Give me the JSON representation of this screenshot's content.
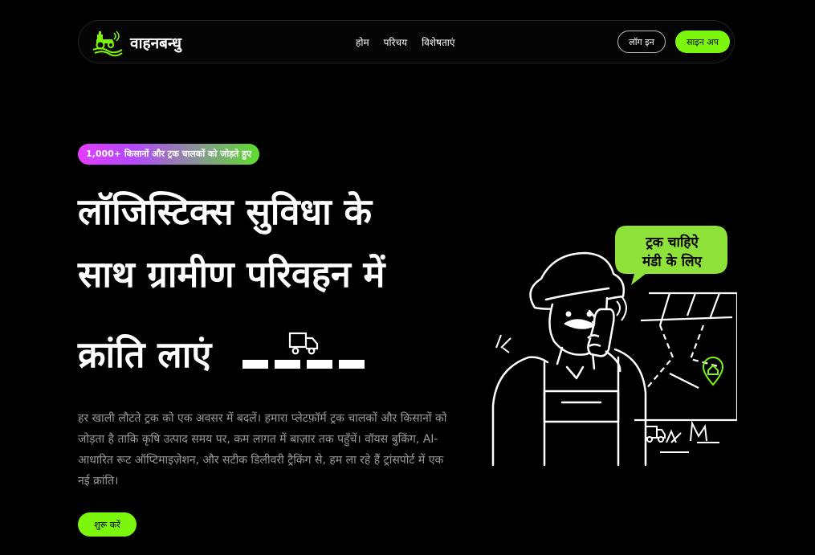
{
  "nav": {
    "brand_name": "वाहनबन्धु",
    "links": [
      "होम",
      "परिचय",
      "विशेषताएं"
    ],
    "login_label": "लॉग इन",
    "signup_label": "साइन अप"
  },
  "hero": {
    "badge": "1,000+ किसानों और ट्रक चालकों को जोड़ते हुए",
    "title_lines": [
      "लॉजिस्टिक्स सुविधा के",
      "साथ ग्रामीण परिवहन में",
      "क्रांति लाएं"
    ],
    "description": "हर खाली लौटते ट्रक को एक अवसर में बदलें। हमारा प्लेटफ़ॉर्म ट्रक चालकों और किसानों को जोड़ता है ताकि कृषि उत्पाद समय पर, कम लागत में बाज़ार तक पहुँचें। वॉयस बुकिंग, AI-आधारित रूट ऑप्टिमाइज़ेशन, और सटीक डिलीवरी ट्रैकिंग से, हम ला रहे हैं ट्रांसपोर्ट में एक नई क्रांति।",
    "cta_label": "शुरू करें"
  },
  "illustration": {
    "speech_bubble": [
      "ट्रक चाहिऐ",
      "मंडी के लिए"
    ]
  },
  "colors": {
    "accent": "#7cf60d",
    "background": "#000000",
    "text": "#ffffff",
    "muted_text": "#9a9a9a",
    "badge_gradient": [
      "#e23dff",
      "#5dde2d"
    ]
  },
  "icons": [
    "tractor-logo-icon",
    "truck-icon",
    "map-pin-icon",
    "phone-icon"
  ]
}
